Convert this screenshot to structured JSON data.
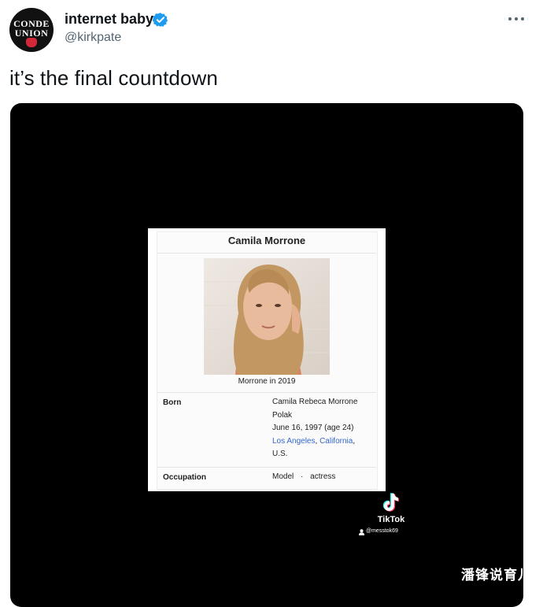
{
  "tweet": {
    "avatar_line1": "CONDE",
    "avatar_line2": "UNION",
    "display_name": "internet baby",
    "handle": "@kirkpate",
    "text": "it’s the final countdown",
    "accent_color": "#1d9bf0"
  },
  "video": {
    "infobox": {
      "title": "Camila Morrone",
      "image_caption": "Morrone in 2019",
      "born_label": "Born",
      "born_line1": "Camila Rebeca Morrone",
      "born_line2": "Polak",
      "born_line3": "June 16, 1997 (age 24)",
      "born_place_city": "Los Angeles",
      "born_place_sep": ", ",
      "born_place_state": "California",
      "born_place_end": ",",
      "born_line5": "U.S.",
      "occupation_label": "Occupation",
      "occupation_item1": "Model",
      "occupation_sep": "·",
      "occupation_item2": "actress"
    },
    "tiktok": {
      "brand": "TikTok",
      "username": "@messtok69"
    },
    "watermark": "潘锋说育儿"
  }
}
